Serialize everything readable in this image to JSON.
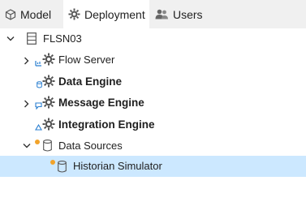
{
  "tabs": [
    {
      "label": "Model",
      "icon": "cube-icon"
    },
    {
      "label": "Deployment",
      "icon": "gear-icon",
      "active": true
    },
    {
      "label": "Users",
      "icon": "users-icon"
    }
  ],
  "tree": {
    "root": "FLSN03",
    "items": [
      {
        "label": "Flow Server"
      },
      {
        "label": "Data Engine"
      },
      {
        "label": "Message Engine"
      },
      {
        "label": "Integration Engine"
      },
      {
        "label": "Data Sources"
      },
      {
        "label": "Historian Simulator"
      }
    ]
  },
  "colors": {
    "selection": "#cce8ff",
    "status_dot": "#f2a32a",
    "sub_icon_blue": "#2a7fd0",
    "tabbar": "#f0f0f0"
  }
}
